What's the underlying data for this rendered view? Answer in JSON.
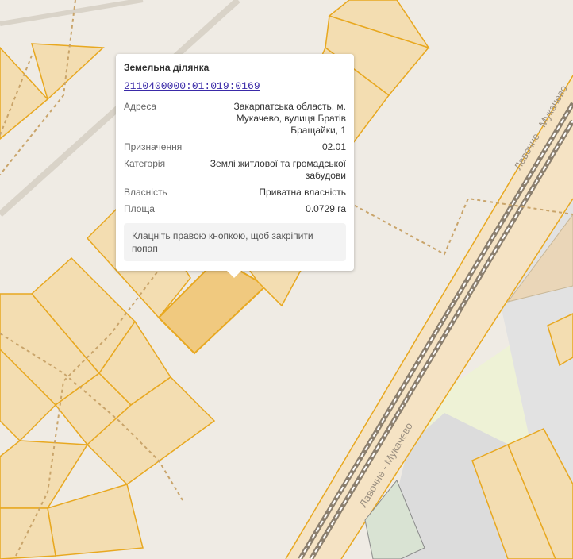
{
  "map": {
    "road_label_1": "Лавочне - Мукачево",
    "road_label_2": "Лавочне - Мукачево",
    "colors": {
      "background": "#efebe4",
      "parcel_fill": "#f3ddb1",
      "parcel_stroke": "#e8a820",
      "selected_fill": "#f0c97f",
      "road_fill": "#f5e3c4",
      "rail": "#8b7f6e",
      "green_area": "#eef2d6",
      "grey_area": "#dcdcdc"
    }
  },
  "popup": {
    "title": "Земельна ділянка",
    "cadastral_number": "2110400000:01:019:0169",
    "rows": [
      {
        "label": "Адреса",
        "value": "Закарпатська область, м. Мукачево, вулиця Братів Бращайки, 1"
      },
      {
        "label": "Призначення",
        "value": "02.01"
      },
      {
        "label": "Категорія",
        "value": "Землі житлової та громадської забудови"
      },
      {
        "label": "Власність",
        "value": "Приватна власність"
      },
      {
        "label": "Площа",
        "value": "0.0729 га"
      }
    ],
    "hint": "Клацніть правою кнопкою, щоб закріпити попап"
  }
}
